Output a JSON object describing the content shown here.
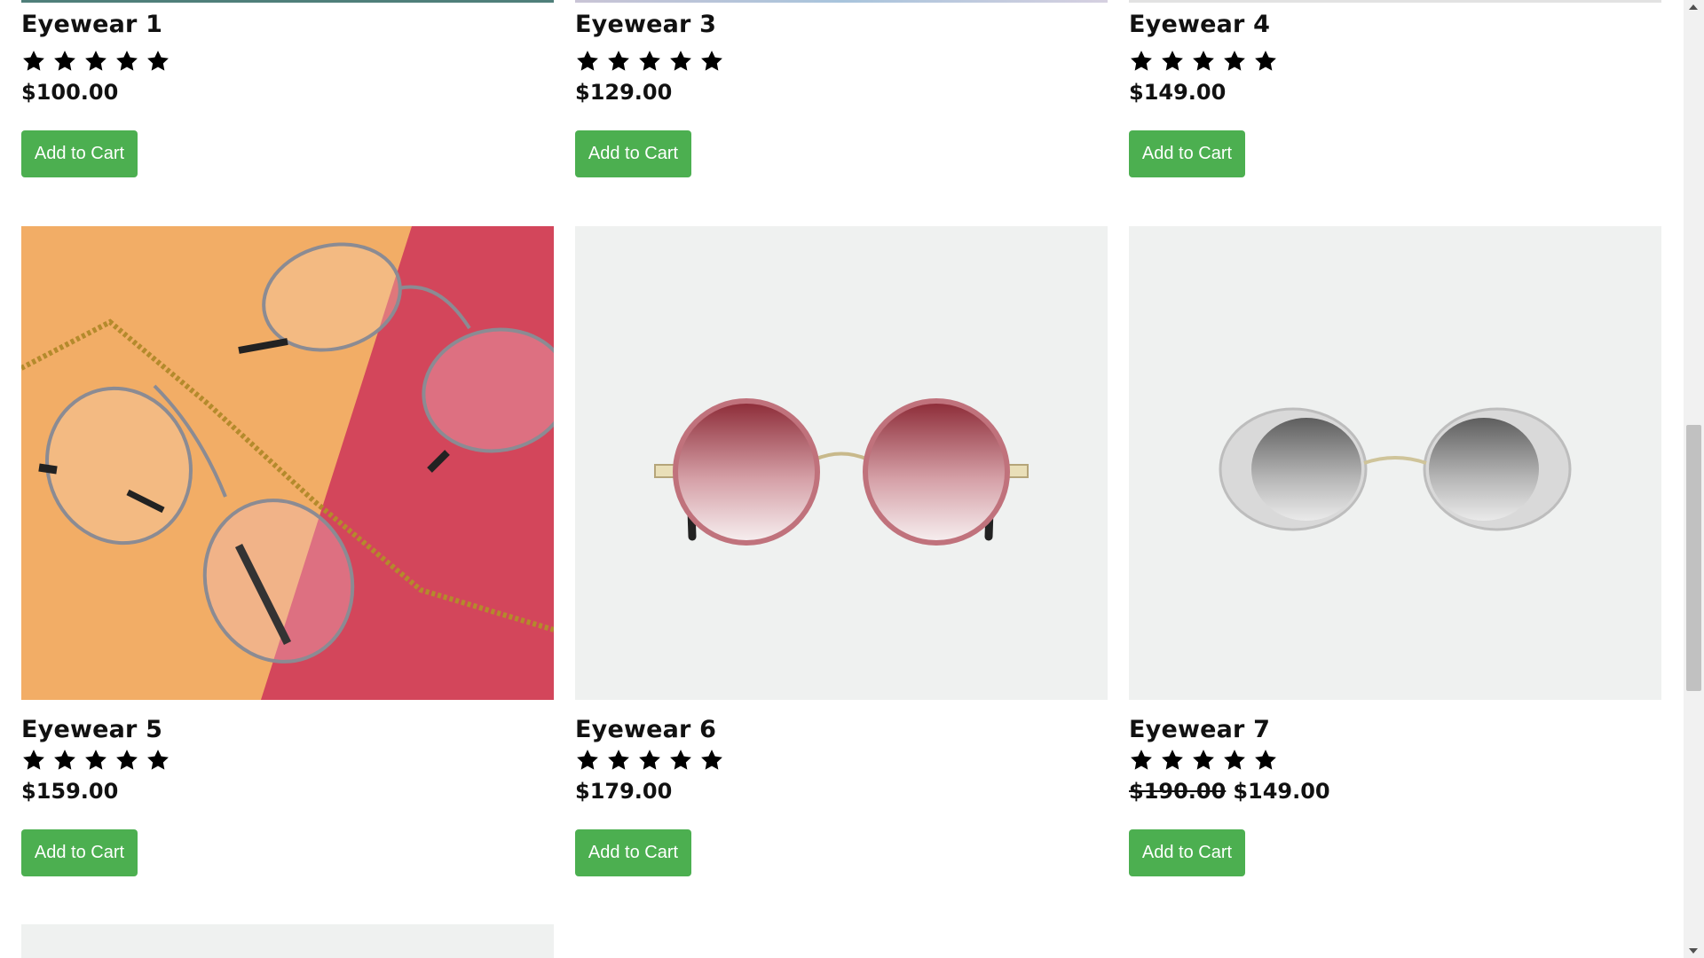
{
  "products_row1": [
    {
      "name": "Eyewear 1",
      "rating": 5,
      "price": "$100.00",
      "button": "Add to Cart",
      "strip_color": "#4f7f7a"
    },
    {
      "name": "Eyewear 3",
      "rating": 5,
      "price": "$129.00",
      "button": "Add to Cart",
      "strip_color": "#a8c4dc"
    },
    {
      "name": "Eyewear 4",
      "rating": 5,
      "price": "$149.00",
      "button": "Add to Cart",
      "strip_color": "#e2e2e2"
    }
  ],
  "products_row2": [
    {
      "name": "Eyewear 5",
      "rating": 5,
      "price": "$159.00",
      "button": "Add to Cart",
      "image": "metal-round-glasses-on-orange-red-backdrop"
    },
    {
      "name": "Eyewear 6",
      "rating": 5,
      "price": "$179.00",
      "button": "Add to Cart",
      "image": "rose-tinted-round-sunglasses"
    },
    {
      "name": "Eyewear 7",
      "rating": 5,
      "old_price": "$190.00",
      "price": "$149.00",
      "button": "Add to Cart",
      "image": "grey-round-sunglasses"
    }
  ],
  "colors": {
    "button_bg": "#4caf50",
    "button_text": "#ffffff",
    "star": "#000000",
    "text": "#111111",
    "image_bg": "#eff1f0"
  },
  "scroll": {
    "position_fraction": 0.62
  }
}
